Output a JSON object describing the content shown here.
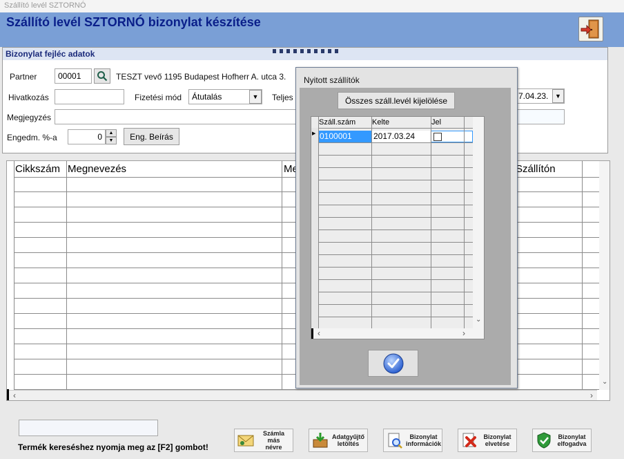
{
  "window": {
    "title": "Szállító levél SZTORNÓ"
  },
  "page": {
    "heading": "Szállító levél SZTORNÓ bizonylat készítése"
  },
  "header": {
    "group_title": "Bizonylat fejléc adatok",
    "partner_label": "Partner",
    "partner_code": "00001",
    "partner_name": "TESZT vevő 1195 Budapest Hofherr A. utca 3.",
    "reference_label": "Hivatkozás",
    "reference_value": "",
    "payment_label": "Fizetési mód",
    "payment_value": "Átutalás",
    "fulfillment_label": "Teljes",
    "fulfillment_date_visible": "7.04.23.",
    "note_label": "Megjegyzés",
    "note_value": "",
    "discount_label": "Engedm. %-a",
    "discount_value": "0",
    "discount_button": "Eng. Beírás"
  },
  "main_grid": {
    "columns": [
      "Cikkszám",
      "Megnevezés",
      "Me",
      "Szállítón"
    ]
  },
  "dialog": {
    "title": "Nyitott szállítók",
    "select_all_button": "Összes száll.levél kijelölése",
    "columns": [
      "Száll.szám",
      "Kelte",
      "Jel"
    ],
    "rows": [
      {
        "number": "0100001",
        "date": "2017.03.24",
        "checked": false
      }
    ]
  },
  "footer": {
    "status_value": "",
    "hint": "Termék kereséshez nyomja meg az [F2] gombot!",
    "buttons": [
      {
        "line1": "Számla más",
        "line2": "névre"
      },
      {
        "line1": "Adatgyűjtő",
        "line2": "letöltés"
      },
      {
        "line1": "Bizonylat",
        "line2": "információk"
      },
      {
        "line1": "Bizonylat",
        "line2": "elvetése"
      },
      {
        "line1": "Bizonylat",
        "line2": "elfogadva"
      }
    ]
  },
  "colors": {
    "header_band": "#7a9fd6",
    "title_text": "#0a1f8a",
    "selected_row": "#3399ff"
  }
}
